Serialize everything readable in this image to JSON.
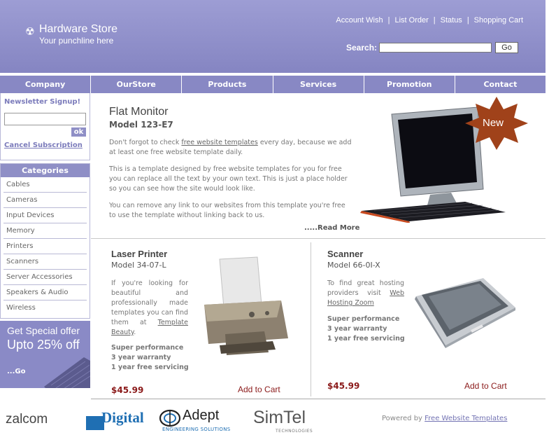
{
  "header": {
    "site_name": "Hardware Store",
    "tagline": "Your punchline here",
    "top_links": [
      "Account Wish",
      "List Order",
      "Status",
      "Shopping Cart"
    ],
    "separator": "|",
    "search_label": "Search:",
    "search_value": "",
    "search_button": "Go"
  },
  "nav": {
    "items": [
      "Company",
      "OurStore",
      "Products",
      "Services",
      "Promotion",
      "Contact"
    ]
  },
  "newsletter": {
    "title": "Newsletter Signup!",
    "input_value": "",
    "ok_label": "ok",
    "cancel_label": "Cancel Subscription"
  },
  "categories": {
    "title": "Categories",
    "items": [
      "Cables",
      "Cameras",
      "Input Devices",
      "Memory",
      "Printers",
      "Scanners",
      "Server Accessories",
      "Speakers & Audio",
      "Wireless"
    ]
  },
  "promo": {
    "line1": "Get Special offer",
    "line2": "Upto 25% off",
    "go": "...Go"
  },
  "featured": {
    "title": "Flat Monitor",
    "model": "Model 123-E7",
    "p1_before": "Don't forgot to check ",
    "p1_link": "free website templates",
    "p1_after": " every day, because we add at least one free website template daily.",
    "p2": "This is a template designed by free website templates for you for free you can replace all the text by your own text. This is just a place holder so you can see how the site would look like.",
    "p3": "You can remove any link to our websites from this template you're free to use the template without linking back to us.",
    "read_more": ".....Read More",
    "badge": "New"
  },
  "products": [
    {
      "title": "Laser Printer",
      "model": "Model 34-07-L",
      "desc_before": "If you're looking for beautiful and professionally made templates you can find them at ",
      "desc_link": "Template Beauty",
      "desc_after": ".",
      "features": [
        "Super performance",
        "3 year warranty",
        "1 year free servicing"
      ],
      "price": "$45.99",
      "cart": "Add to Cart"
    },
    {
      "title": "Scanner",
      "model": "Model 66-0I-X",
      "desc_before": "To find great hosting providers visit ",
      "desc_link": "Web Hosting Zoom",
      "desc_after": "",
      "features": [
        "Super performance",
        "3 year warranty",
        "1 year free servicing"
      ],
      "price": "$45.99",
      "cart": "Add to Cart"
    }
  ],
  "footer": {
    "logos": [
      "zalcom",
      "Digital",
      "Adept",
      "ENGINEERING SOLUTIONS",
      "SimTel",
      "TECHNOLOGIES"
    ],
    "powered_prefix": "Powered by ",
    "powered_link": "Free Website Templates"
  },
  "colors": {
    "header": "#9d9dd4",
    "nav": "#8888c4",
    "price": "#8b1a1a",
    "badge": "#a0421a"
  }
}
